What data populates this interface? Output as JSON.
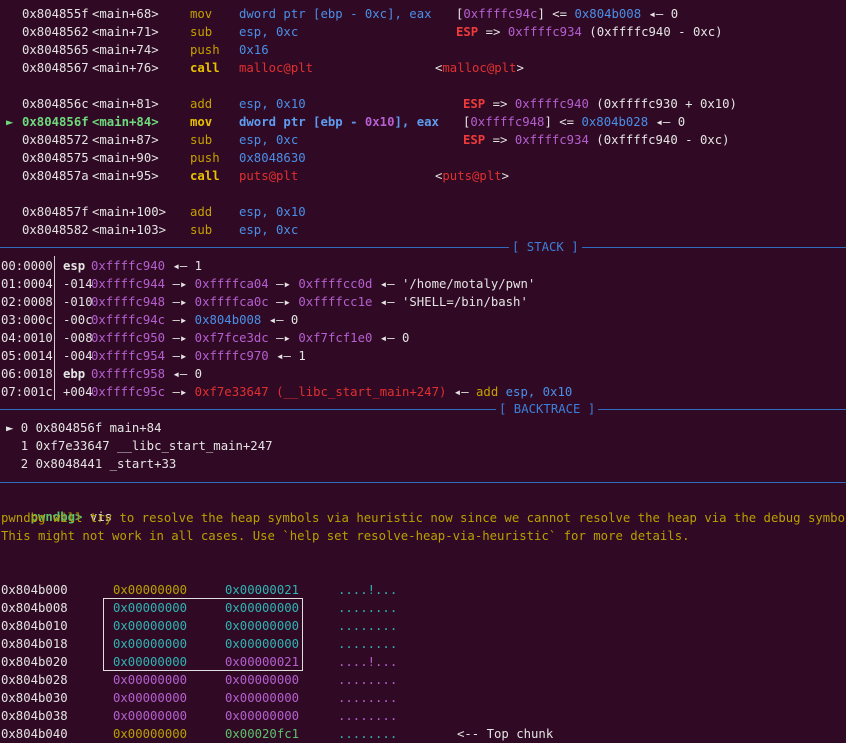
{
  "disasm": [
    {
      "addr": "0x804855f",
      "sym": "<main+68>",
      "mn": "mov",
      "op1": "dword ptr ",
      "op2": "[ebp - 0xc], eax",
      "cm": [
        {
          "t": "[",
          "c": "w"
        },
        {
          "t": "0xffffc94c",
          "c": "m"
        },
        {
          "t": "] <= ",
          "c": "w"
        },
        {
          "t": "0x804b008",
          "c": "b"
        },
        {
          "t": " ◂— 0",
          "c": "w"
        }
      ]
    },
    {
      "addr": "0x8048562",
      "sym": "<main+71>",
      "mn": "sub",
      "op1": "esp, 0xc",
      "cm": [
        {
          "t": "ESP",
          "c": "rb"
        },
        {
          "t": " => ",
          "c": "w"
        },
        {
          "t": "0xffffc934",
          "c": "m"
        },
        {
          "t": " (0xffffc940 - 0xc)",
          "c": "w"
        }
      ]
    },
    {
      "addr": "0x8048565",
      "sym": "<main+74>",
      "mn": "push",
      "op1": "0x16"
    },
    {
      "addr": "0x8048567",
      "sym": "<main+76>",
      "mn": "call",
      "op1": "malloc@plt",
      "cm": [
        {
          "t": "<",
          "c": "w"
        },
        {
          "t": "malloc@plt",
          "c": "r"
        },
        {
          "t": ">",
          "c": "w"
        }
      ]
    },
    {
      "addr": "0x804856c",
      "sym": "<main+81>",
      "mn": "add",
      "op1": "esp, 0x10",
      "cm": [
        {
          "t": "ESP",
          "c": "rb"
        },
        {
          "t": " => ",
          "c": "w"
        },
        {
          "t": "0xffffc940",
          "c": "m"
        },
        {
          "t": " (0xffffc930 + 0x10)",
          "c": "w"
        }
      ]
    },
    {
      "marker": "►",
      "addr": "0x804856f",
      "sym": "<main+84>",
      "mn": "mov",
      "op1": "dword ptr ",
      "op2": "[ebp - ",
      "op3": "0x10",
      "op4": "], eax",
      "cm": [
        {
          "t": "[",
          "c": "w"
        },
        {
          "t": "0xffffc948",
          "c": "m"
        },
        {
          "t": "] <= ",
          "c": "w"
        },
        {
          "t": "0x804b028",
          "c": "b"
        },
        {
          "t": " ◂— 0",
          "c": "w"
        }
      ]
    },
    {
      "addr": "0x8048572",
      "sym": "<main+87>",
      "mn": "sub",
      "op1": "esp, 0xc",
      "cm": [
        {
          "t": "ESP",
          "c": "rb"
        },
        {
          "t": " => ",
          "c": "w"
        },
        {
          "t": "0xffffc934",
          "c": "m"
        },
        {
          "t": " (0xffffc940 - 0xc)",
          "c": "w"
        }
      ]
    },
    {
      "addr": "0x8048575",
      "sym": "<main+90>",
      "mn": "push",
      "op1": "0x8048630"
    },
    {
      "addr": "0x804857a",
      "sym": "<main+95>",
      "mn": "call",
      "op1": "puts@plt",
      "cm": [
        {
          "t": "<",
          "c": "w"
        },
        {
          "t": "puts@plt",
          "c": "r"
        },
        {
          "t": ">",
          "c": "w"
        }
      ]
    },
    {
      "addr": "0x804857f",
      "sym": "<main+100>",
      "mn": "add",
      "op1": "esp, 0x10"
    },
    {
      "addr": "0x8048582",
      "sym": "<main+103>",
      "mn": "sub",
      "op1": "esp, 0xc"
    }
  ],
  "stack_title": "[ STACK ]",
  "stack": [
    {
      "idx": "00:0000",
      "off": "esp",
      "addr": "0xffffc940",
      "rest": [
        {
          "t": " ◂— 1",
          "c": "w"
        }
      ]
    },
    {
      "idx": "01:0004",
      "off": "-014",
      "addr": "0xffffc944",
      "rest": [
        {
          "t": " —▸ ",
          "c": "w"
        },
        {
          "t": "0xffffca04",
          "c": "m"
        },
        {
          "t": " —▸ ",
          "c": "w"
        },
        {
          "t": "0xffffcc0d",
          "c": "m"
        },
        {
          "t": " ◂— '/home/motaly/pwn'",
          "c": "w"
        }
      ]
    },
    {
      "idx": "02:0008",
      "off": "-010",
      "addr": "0xffffc948",
      "rest": [
        {
          "t": " —▸ ",
          "c": "w"
        },
        {
          "t": "0xffffca0c",
          "c": "m"
        },
        {
          "t": " —▸ ",
          "c": "w"
        },
        {
          "t": "0xffffcc1e",
          "c": "m"
        },
        {
          "t": " ◂— 'SHELL=/bin/bash'",
          "c": "w"
        }
      ]
    },
    {
      "idx": "03:000c",
      "off": "-00c",
      "addr": "0xffffc94c",
      "rest": [
        {
          "t": " —▸ ",
          "c": "w"
        },
        {
          "t": "0x804b008",
          "c": "b"
        },
        {
          "t": " ◂— 0",
          "c": "w"
        }
      ]
    },
    {
      "idx": "04:0010",
      "off": "-008",
      "addr": "0xffffc950",
      "rest": [
        {
          "t": " —▸ ",
          "c": "w"
        },
        {
          "t": "0xf7fce3dc",
          "c": "m"
        },
        {
          "t": " —▸ ",
          "c": "w"
        },
        {
          "t": "0xf7fcf1e0",
          "c": "m"
        },
        {
          "t": " ◂— 0",
          "c": "w"
        }
      ]
    },
    {
      "idx": "05:0014",
      "off": "-004",
      "addr": "0xffffc954",
      "rest": [
        {
          "t": " —▸ ",
          "c": "w"
        },
        {
          "t": "0xffffc970",
          "c": "m"
        },
        {
          "t": " ◂— 1",
          "c": "w"
        }
      ]
    },
    {
      "idx": "06:0018",
      "off": "ebp",
      "addr": "0xffffc958",
      "rest": [
        {
          "t": " ◂— 0",
          "c": "w"
        }
      ]
    },
    {
      "idx": "07:001c",
      "off": "+004",
      "addr": "0xffffc95c",
      "rest": [
        {
          "t": " —▸ ",
          "c": "w"
        },
        {
          "t": "0xf7e33647 (__libc_start_main+247)",
          "c": "r"
        },
        {
          "t": " ◂— ",
          "c": "w"
        },
        {
          "t": "add",
          "c": "y"
        },
        {
          "t": " ",
          "c": "w"
        },
        {
          "t": "esp, 0x10",
          "c": "b"
        }
      ]
    }
  ],
  "backtrace_title": "[ BACKTRACE ]",
  "backtrace": [
    {
      "text": "► 0 0x804856f main+84"
    },
    {
      "text": "  1 0xf7e33647 __libc_start_main+247"
    },
    {
      "text": "  2 0x8048441 _start+33"
    }
  ],
  "prompt": "pwndbg>",
  "command": " vis",
  "warnings": [
    "pwndbg will try to resolve the heap symbols via heuristic now since we cannot resolve the heap via the debug symbols.",
    "This might not work in all cases. Use `help set resolve-heap-via-heuristic` for more details."
  ],
  "heap": [
    {
      "addr": "0x804b000",
      "v1": "0x00000000",
      "c1": "dy",
      "v2": "0x00000021",
      "c2": "c",
      "ascii": "....!...",
      "ac": "c"
    },
    {
      "addr": "0x804b008",
      "v1": "0x00000000",
      "c1": "c",
      "v2": "0x00000000",
      "c2": "c",
      "ascii": "........",
      "ac": "c"
    },
    {
      "addr": "0x804b010",
      "v1": "0x00000000",
      "c1": "c",
      "v2": "0x00000000",
      "c2": "c",
      "ascii": "........",
      "ac": "c"
    },
    {
      "addr": "0x804b018",
      "v1": "0x00000000",
      "c1": "c",
      "v2": "0x00000000",
      "c2": "c",
      "ascii": "........",
      "ac": "c"
    },
    {
      "addr": "0x804b020",
      "v1": "0x00000000",
      "c1": "c",
      "v2": "0x00000021",
      "c2": "m",
      "ascii": "....!...",
      "ac": "m"
    },
    {
      "addr": "0x804b028",
      "v1": "0x00000000",
      "c1": "m",
      "v2": "0x00000000",
      "c2": "m",
      "ascii": "........",
      "ac": "m"
    },
    {
      "addr": "0x804b030",
      "v1": "0x00000000",
      "c1": "m",
      "v2": "0x00000000",
      "c2": "m",
      "ascii": "........",
      "ac": "m"
    },
    {
      "addr": "0x804b038",
      "v1": "0x00000000",
      "c1": "m",
      "v2": "0x00000000",
      "c2": "m",
      "ascii": "........",
      "ac": "m"
    },
    {
      "addr": "0x804b040",
      "v1": "0x00000000",
      "c1": "dy",
      "v2": "0x00020fc1",
      "c2": "g",
      "ascii": "........",
      "ac": "c",
      "note": "<-- Top chunk"
    }
  ],
  "colors": {
    "background": "#300a24",
    "separator": "#2f6bbf",
    "current_line": "#6ddb7c"
  }
}
